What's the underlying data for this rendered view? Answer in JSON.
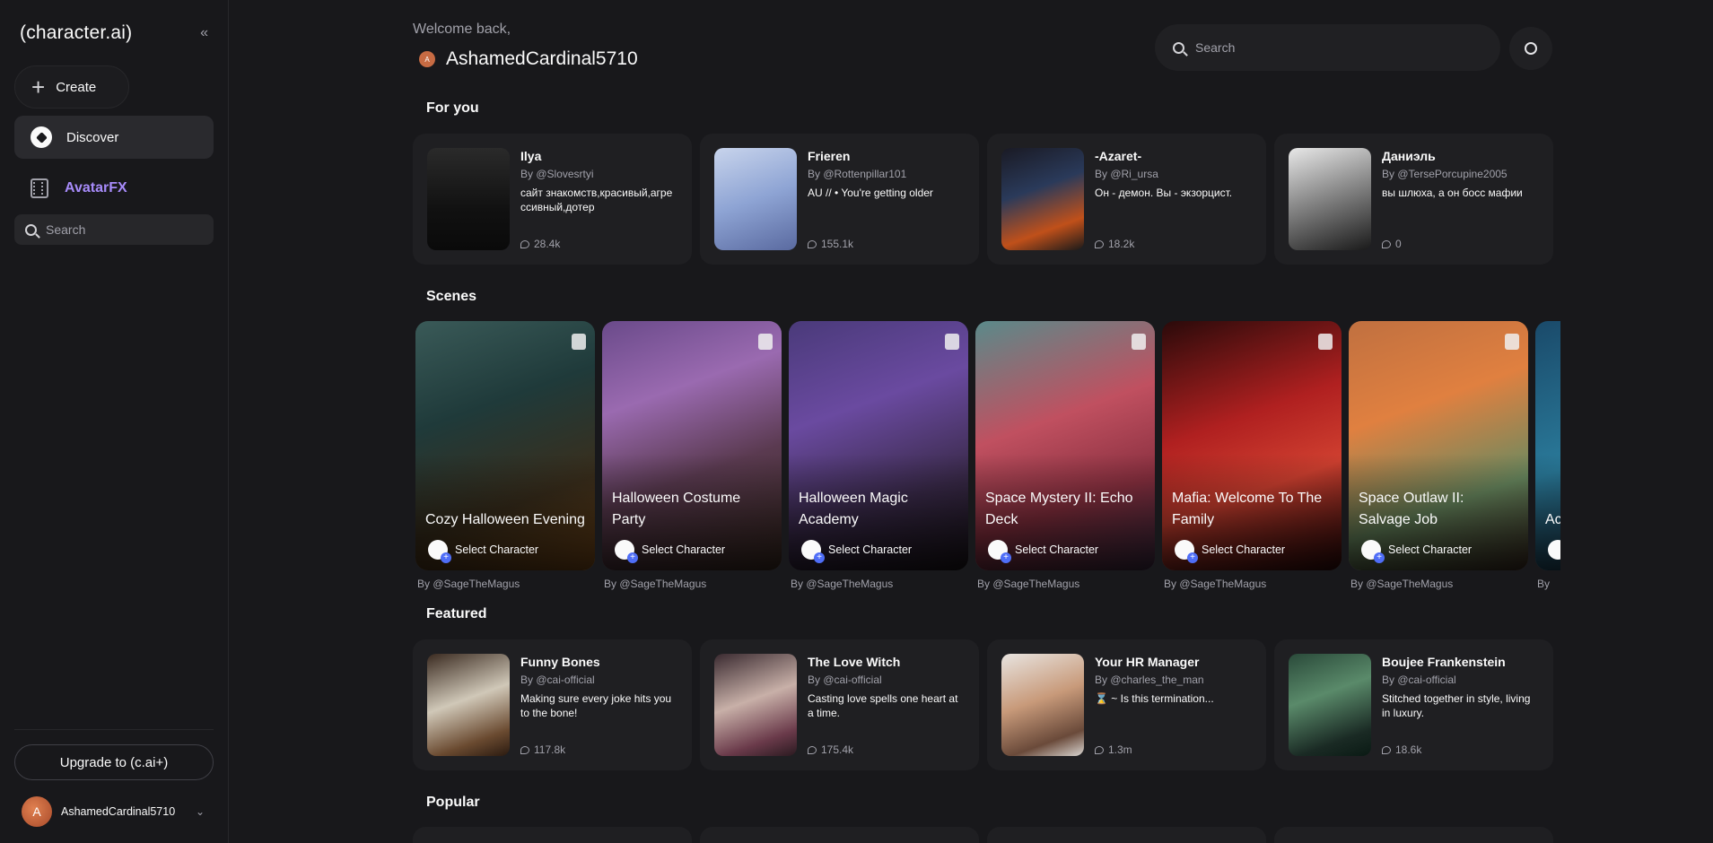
{
  "sidebar": {
    "brand": "(character.ai)",
    "collapse_icon": "«",
    "create_label": "Create",
    "discover_label": "Discover",
    "avatarfx_label": "AvatarFX",
    "search_placeholder": "Search",
    "upgrade_label": "Upgrade to (c.ai+)",
    "user_initial": "A",
    "user_name": "AshamedCardinal5710"
  },
  "header": {
    "welcome": "Welcome back,",
    "user_initial": "A",
    "user_name": "AshamedCardinal5710",
    "search_placeholder": "Search"
  },
  "sections": {
    "for_you": "For you",
    "scenes": "Scenes",
    "featured": "Featured",
    "popular": "Popular"
  },
  "for_you": [
    {
      "name": "Ilya",
      "by": "By @Slovesrtyi",
      "desc": "сайт знакомств,красивый,агрессивный,дотер",
      "count": "28.4k"
    },
    {
      "name": "Frieren",
      "by": "By @Rottenpillar101",
      "desc": "AU // • You're getting older",
      "count": "155.1k"
    },
    {
      "name": "-Azaret-",
      "by": "By @Ri_ursa",
      "desc": "Он - демон. Вы - экзорцист.",
      "count": "18.2k"
    },
    {
      "name": "Даниэль",
      "by": "By @TersePorcupine2005",
      "desc": "вы шлюха, а он босс мафии",
      "count": "0"
    }
  ],
  "scenes": [
    {
      "title": "Cozy Halloween Evening",
      "select": "Select Character",
      "by": "By @SageTheMagus"
    },
    {
      "title": "Halloween Costume Party",
      "select": "Select Character",
      "by": "By @SageTheMagus"
    },
    {
      "title": "Halloween Magic Academy",
      "select": "Select Character",
      "by": "By @SageTheMagus"
    },
    {
      "title": "Space Mystery II: Echo Deck",
      "select": "Select Character",
      "by": "By @SageTheMagus"
    },
    {
      "title": "Mafia: Welcome To The Family",
      "select": "Select Character",
      "by": "By @SageTheMagus"
    },
    {
      "title": "Space Outlaw II: Salvage Job",
      "select": "Select Character",
      "by": "By @SageTheMagus"
    },
    {
      "title": "Ac Se",
      "select": "",
      "by": "By"
    }
  ],
  "featured": [
    {
      "name": "Funny Bones",
      "by": "By @cai-official",
      "desc": "Making sure every joke hits you to the bone!",
      "count": "117.8k"
    },
    {
      "name": "The Love Witch",
      "by": "By @cai-official",
      "desc": "Casting love spells one heart at a time.",
      "count": "175.4k"
    },
    {
      "name": "Your HR Manager",
      "by": "By @charles_the_man",
      "desc": "⌛ ~ Is this termination...",
      "count": "1.3m"
    },
    {
      "name": "Boujee Frankenstein",
      "by": "By @cai-official",
      "desc": "Stitched together in style, living in luxury.",
      "count": "18.6k"
    }
  ],
  "colors": {
    "background": "#18181b",
    "card": "#1f1f22",
    "accent_avatarfx": "#a78bfa"
  }
}
